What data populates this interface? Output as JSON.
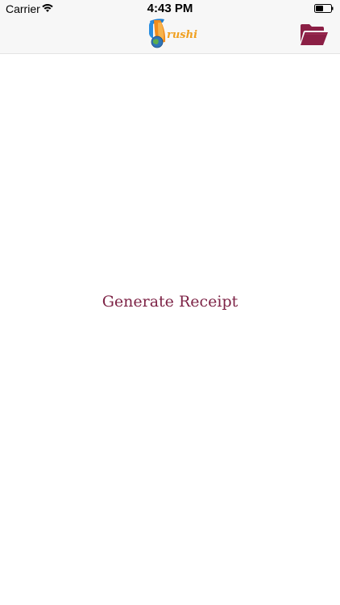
{
  "status_bar": {
    "carrier": "Carrier",
    "time": "4:43 PM",
    "wifi_icon": "wifi-icon",
    "battery_icon": "battery-icon"
  },
  "nav_bar": {
    "logo_text": "rushi",
    "folder_icon": "folder-open-icon",
    "accent_color": "#8b1f45"
  },
  "main": {
    "generate_label": "Generate Receipt",
    "label_color": "#7d2346"
  }
}
